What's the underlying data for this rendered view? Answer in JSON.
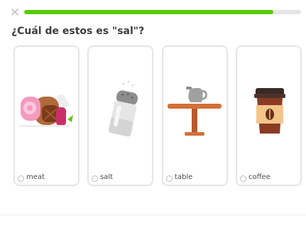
{
  "header": {
    "close_glyph": "×",
    "progress_percent": 90
  },
  "question": {
    "text": "¿Cuál de estos es \"sal\"?"
  },
  "options": [
    {
      "label": "meat",
      "icon": "meat-icon"
    },
    {
      "label": "salt",
      "icon": "salt-shaker-icon"
    },
    {
      "label": "table",
      "icon": "table-with-pitcher-icon"
    },
    {
      "label": "coffee",
      "icon": "coffee-cup-icon"
    }
  ],
  "colors": {
    "progress": "#58cc02",
    "track": "#e5e5e5",
    "card_border": "#e5e5e5",
    "text": "#3c3c3c"
  }
}
